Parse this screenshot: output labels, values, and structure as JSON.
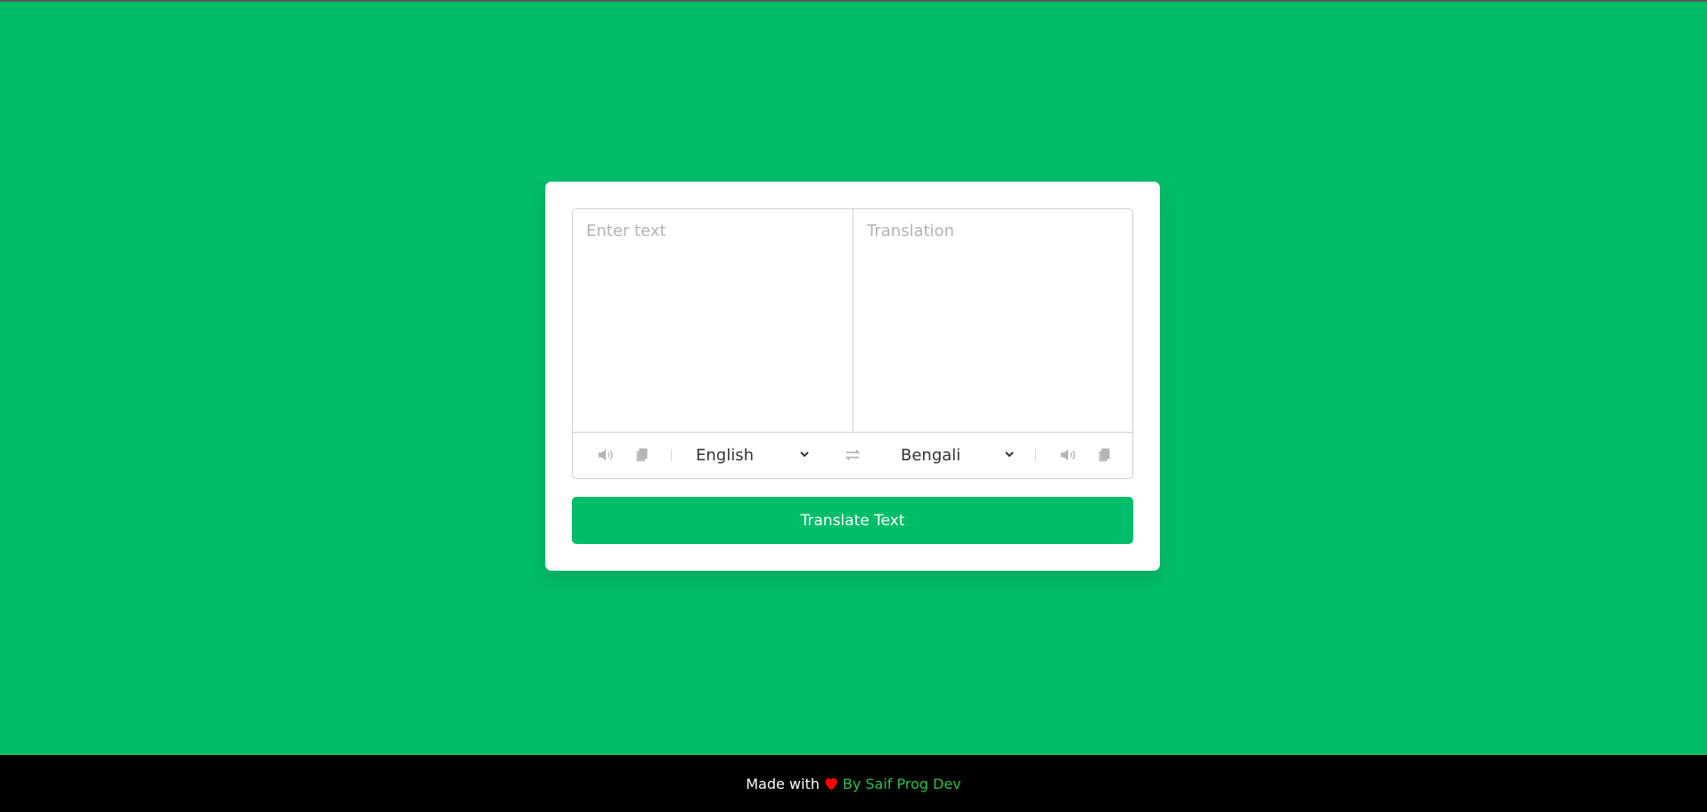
{
  "colors": {
    "accent": "#00bd69",
    "footer_bg": "#000000",
    "heart": "#ff0000",
    "author": "#27c24c"
  },
  "input": {
    "placeholder": "Enter text",
    "value": ""
  },
  "output": {
    "placeholder": "Translation",
    "value": ""
  },
  "controls": {
    "from": {
      "speak_icon": "volume-icon",
      "copy_icon": "copy-icon",
      "selected": "English",
      "options": [
        "English"
      ]
    },
    "exchange_icon": "exchange-icon",
    "to": {
      "selected": "Bengali",
      "options": [
        "Bengali"
      ],
      "speak_icon": "volume-icon",
      "copy_icon": "copy-icon"
    }
  },
  "translate_button": {
    "label": "Translate Text"
  },
  "footer": {
    "made_with": "Made with",
    "heart_icon": "heart-icon",
    "author": "By Saif Prog Dev"
  }
}
